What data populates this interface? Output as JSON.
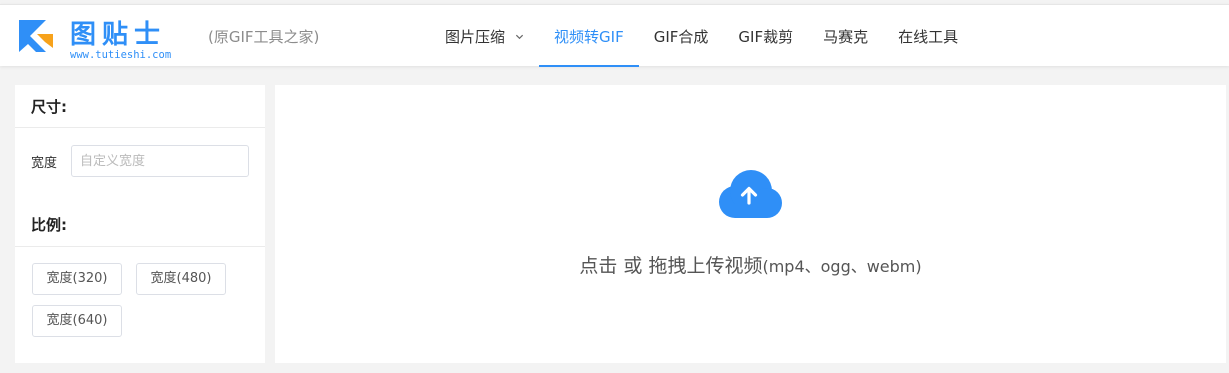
{
  "header": {
    "logo_name": "图贴士",
    "logo_url": "www.tutieshi.com",
    "tagline": "(原GIF工具之家)",
    "nav": [
      {
        "label": "图片压缩",
        "has_dropdown": true,
        "active": false
      },
      {
        "label": "视频转GIF",
        "has_dropdown": false,
        "active": true
      },
      {
        "label": "GIF合成",
        "has_dropdown": false,
        "active": false
      },
      {
        "label": "GIF裁剪",
        "has_dropdown": false,
        "active": false
      },
      {
        "label": "马赛克",
        "has_dropdown": false,
        "active": false
      },
      {
        "label": "在线工具",
        "has_dropdown": false,
        "active": false
      }
    ]
  },
  "sidebar": {
    "size_title": "尺寸:",
    "width_label": "宽度",
    "width_value": "",
    "width_placeholder": "自定义宽度",
    "ratio_title": "比例:",
    "ratio_buttons": [
      "宽度(320)",
      "宽度(480)",
      "宽度(640)"
    ]
  },
  "upload": {
    "main_text": "点击 或 拖拽上传视频",
    "formats_text": "(mp4、ogg、webm)",
    "icon": "cloud-upload-icon"
  },
  "colors": {
    "accent": "#2f8ff7",
    "page_bg": "#f3f3f3",
    "panel_bg": "#ffffff",
    "logo_orange": "#f7a21b"
  }
}
